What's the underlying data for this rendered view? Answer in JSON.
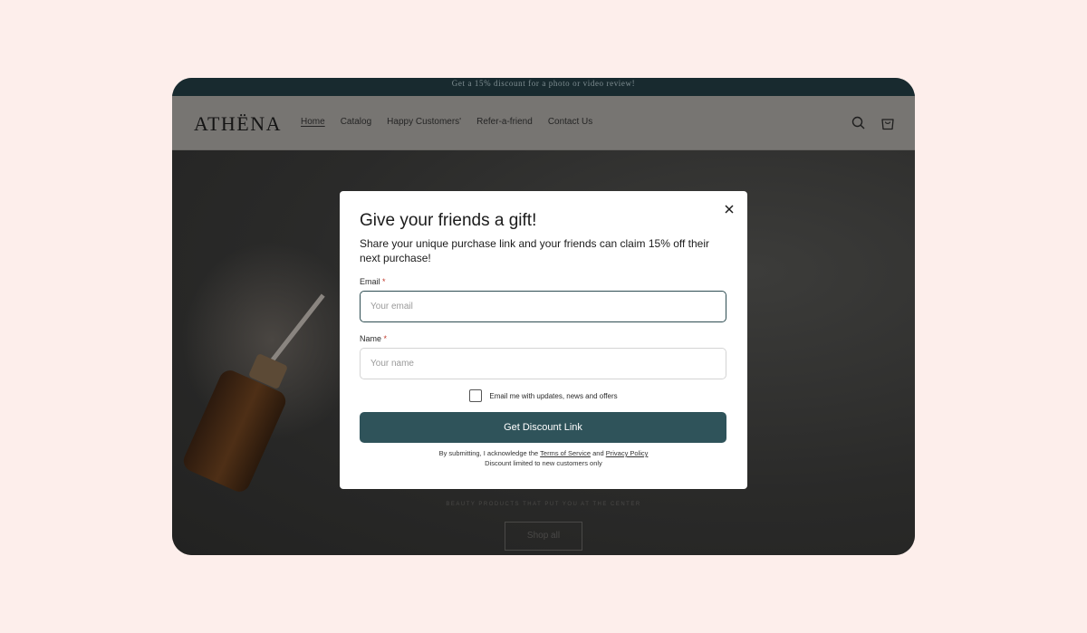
{
  "announcement": {
    "text": "Get a 15% discount for a photo or video review!"
  },
  "header": {
    "logo": "ATHËNA",
    "nav": [
      {
        "label": "Home",
        "active": true
      },
      {
        "label": "Catalog"
      },
      {
        "label": "Happy Customers'"
      },
      {
        "label": "Refer-a-friend"
      },
      {
        "label": "Contact Us"
      }
    ],
    "icons": [
      "search-icon",
      "cart-icon"
    ]
  },
  "hero": {
    "subtitle": "BEAUTY PRODUCTS THAT PUT YOU AT THE CENTER",
    "cta": "Shop all"
  },
  "modal": {
    "title": "Give your friends a gift!",
    "description": "Share your unique purchase link and your friends can claim 15% off their next purchase!",
    "email_label": "Email",
    "email_placeholder": "Your email",
    "name_label": "Name",
    "name_placeholder": "Your name",
    "required_marker": "*",
    "consent_label": "Email me with updates, news and offers",
    "submit_label": "Get Discount Link",
    "legal_prefix": "By submitting, I acknowledge the",
    "terms_link": "Terms of Service",
    "legal_and": "and",
    "privacy_link": "Privacy Policy",
    "legal_note": "Discount limited to new customers only",
    "close_icon": "close-icon"
  },
  "colors": {
    "page_bg": "#fdeeeb",
    "primary_button": "#2f535a",
    "announcement_bg": "#182a2f"
  }
}
